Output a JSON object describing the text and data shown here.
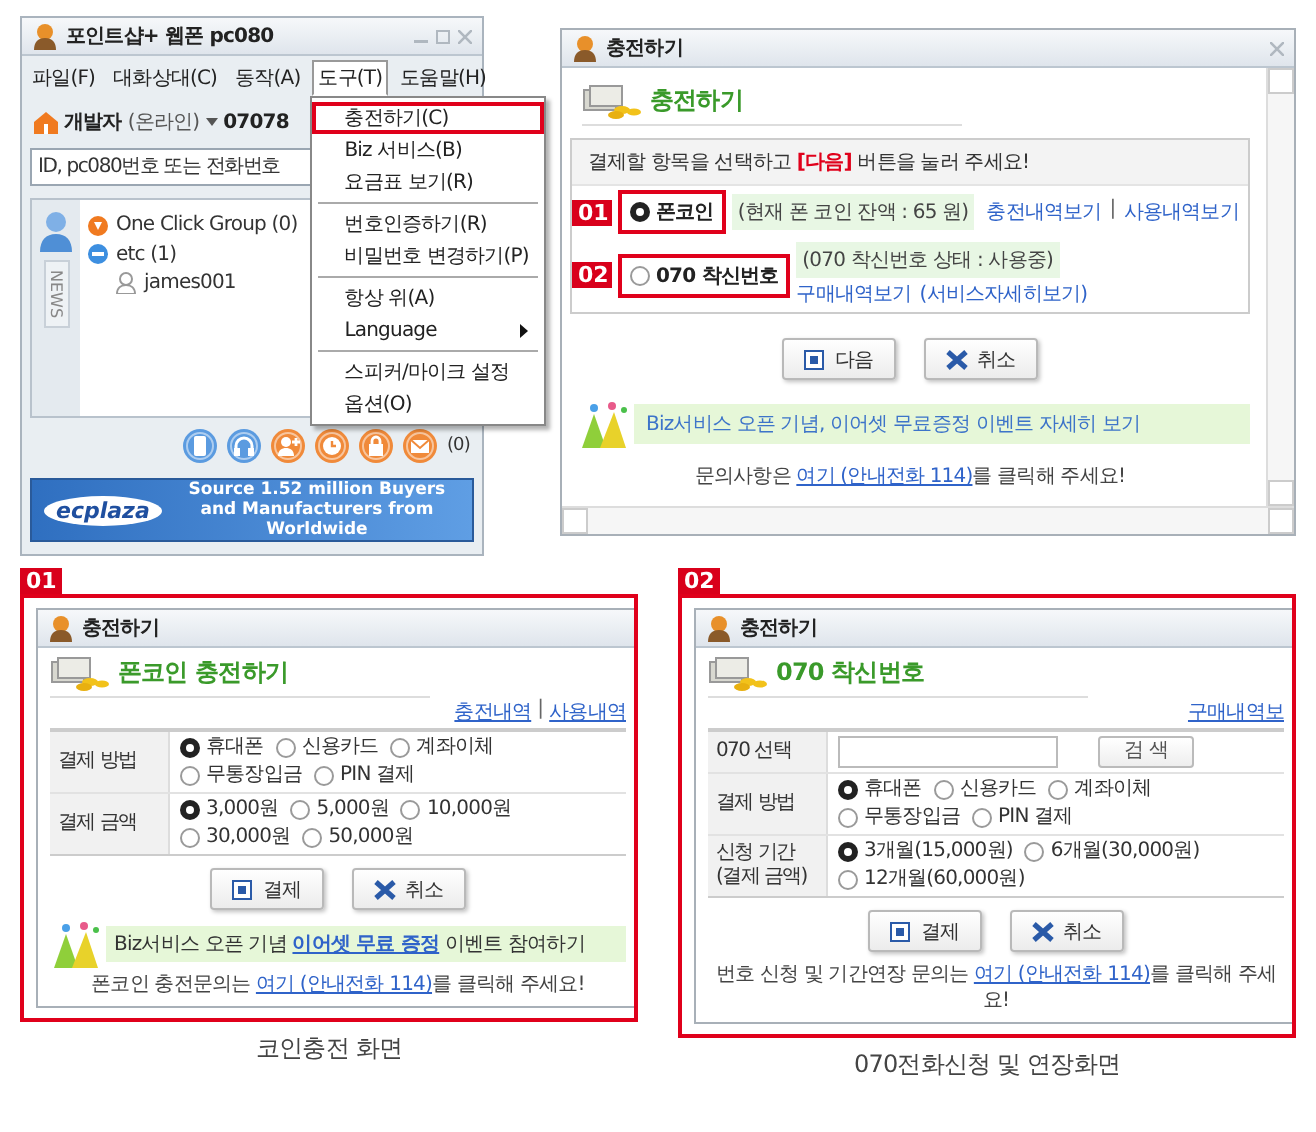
{
  "messenger": {
    "title": "포인트샵+ 웹폰 pc080",
    "menubar": [
      {
        "label": "파일(F)",
        "selected": false
      },
      {
        "label": "대화상대(C)",
        "selected": false
      },
      {
        "label": "동작(A)",
        "selected": false
      },
      {
        "label": "도구(T)",
        "selected": true
      },
      {
        "label": "도움말(H)",
        "selected": false
      }
    ],
    "user": {
      "name": "개발자",
      "status": "(온라인)",
      "number": "07078"
    },
    "search": {
      "placeholder": "ID, pc080번호 또는 전화번호"
    },
    "side_tab": "NEWS",
    "contacts": [
      {
        "label": "One Click Group (0)",
        "kind": "quick"
      },
      {
        "label": "etc (1)",
        "kind": "group",
        "children": [
          {
            "label": "james001",
            "kind": "user"
          }
        ]
      }
    ],
    "toolbar_count": "(0)",
    "banner": {
      "logo": "ecplaza",
      "text": "Source 1.52 million Buyers and Manufacturers  from Worldwide"
    }
  },
  "tools_menu": {
    "sections": [
      {
        "items": [
          {
            "label": "충전하기(C)",
            "highlighted": true,
            "submenu": false
          },
          {
            "label": "Biz 서비스(B)",
            "highlighted": false,
            "submenu": false
          },
          {
            "label": "요금표 보기(R)",
            "highlighted": false,
            "submenu": false
          }
        ]
      },
      {
        "items": [
          {
            "label": "번호인증하기(R)",
            "highlighted": false,
            "submenu": false
          },
          {
            "label": "비밀번호 변경하기(P)",
            "highlighted": false,
            "submenu": false
          }
        ]
      },
      {
        "items": [
          {
            "label": "항상 위(A)",
            "highlighted": false,
            "submenu": false
          },
          {
            "label": "Language",
            "highlighted": false,
            "submenu": true
          }
        ]
      },
      {
        "items": [
          {
            "label": "스피커/마이크 설정",
            "highlighted": false,
            "submenu": false
          },
          {
            "label": "옵션(O)",
            "highlighted": false,
            "submenu": false
          }
        ]
      }
    ]
  },
  "charge_dialog": {
    "title": "충전하기",
    "heading": "충전하기",
    "instruction": "결제할 항목을 선택하고 **[다음]** 버튼을 눌러 주세요!",
    "options": [
      {
        "badge": "01",
        "label": "폰코인",
        "selected": true,
        "status": "(현재 폰 코인 잔액 : 65 원)",
        "links": [
          "충전내역보기",
          "사용내역보기"
        ],
        "separator": "|"
      },
      {
        "badge": "02",
        "label": "070 착신번호",
        "selected": false,
        "status": "(070 착신번호 상태 : 사용중)",
        "links": [
          "구매내역보기",
          "(서비스자세히보기)"
        ]
      }
    ],
    "buttons": [
      {
        "label": "다음",
        "kind": "next"
      },
      {
        "label": "취소",
        "kind": "cancel"
      }
    ],
    "banner": "Biz서비스 오픈 기념, 이어셋 무료증정 이벤트 자세히 보기",
    "contact": {
      "before": "문의사항은 ",
      "link": "여기 (안내전화 114)",
      "after": "를 클릭해 주세요!"
    }
  },
  "panels": [
    {
      "badge": "01",
      "title": "충전하기",
      "heading": "폰코인 충전하기",
      "links": [
        "충전내역",
        "사용내역"
      ],
      "separator": "|",
      "rows": [
        {
          "label": "결제 방법",
          "kind": "radios",
          "options": [
            {
              "label": "휴대폰",
              "selected": true
            },
            {
              "label": "신용카드",
              "selected": false
            },
            {
              "label": "계좌이체",
              "selected": false
            },
            {
              "label": "무통장입금",
              "selected": false
            },
            {
              "label": "PIN 결제",
              "selected": false
            }
          ]
        },
        {
          "label": "결제 금액",
          "kind": "radios",
          "options": [
            {
              "label": "3,000원",
              "selected": true
            },
            {
              "label": "5,000원",
              "selected": false
            },
            {
              "label": "10,000원",
              "selected": false
            },
            {
              "label": "30,000원",
              "selected": false
            },
            {
              "label": "50,000원",
              "selected": false
            }
          ]
        }
      ],
      "buttons": [
        {
          "label": "결제",
          "kind": "pay"
        },
        {
          "label": "취소",
          "kind": "cancel"
        }
      ],
      "banner": {
        "before": "Biz서비스 오픈 기념 ",
        "link": "이어셋 무료 증정",
        "after": " 이벤트 참여하기"
      },
      "contact": {
        "before": "폰코인 충전문의는 ",
        "link": "여기 (안내전화 114)",
        "after": "를 클릭해 주세요!"
      },
      "caption": "코인충전 화면"
    },
    {
      "badge": "02",
      "title": "충전하기",
      "heading": "070 착신번호",
      "links": [
        "구매내역보"
      ],
      "rows": [
        {
          "label": "070 선택",
          "kind": "search",
          "button": "검 색"
        },
        {
          "label": "결제 방법",
          "kind": "radios",
          "options": [
            {
              "label": "휴대폰",
              "selected": true
            },
            {
              "label": "신용카드",
              "selected": false
            },
            {
              "label": "계좌이체",
              "selected": false
            },
            {
              "label": "무통장입금",
              "selected": false
            },
            {
              "label": "PIN 결제",
              "selected": false
            }
          ]
        },
        {
          "label": "신청 기간\n(결제 금액)",
          "kind": "radios",
          "options": [
            {
              "label": "3개월(15,000원)",
              "selected": true
            },
            {
              "label": "6개월(30,000원)",
              "selected": false
            },
            {
              "label": "12개월(60,000원)",
              "selected": false
            }
          ]
        }
      ],
      "buttons": [
        {
          "label": "결제",
          "kind": "pay"
        },
        {
          "label": "취소",
          "kind": "cancel"
        }
      ],
      "contact": {
        "before": "번호 신청 및 기간연장 문의는 ",
        "link": "여기 (안내전화 114)",
        "after": "를 클릭해 주세요!"
      },
      "caption": "070전화신청 및 연장화면"
    }
  ]
}
